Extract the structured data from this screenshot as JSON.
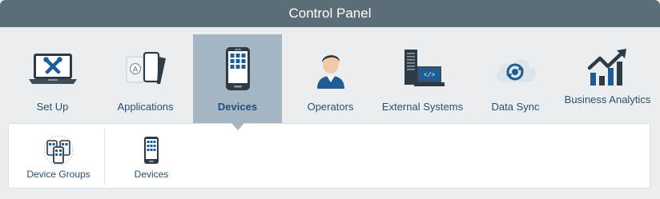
{
  "window": {
    "title": "Control Panel"
  },
  "colors": {
    "titlebar": "#5d6d78",
    "active_tab": "#a5b6c2",
    "label_text": "#2c4e6e",
    "panel_background": "#ebeef0"
  },
  "menu": {
    "items": [
      {
        "label": "Set Up",
        "icon": "laptop-tools-icon",
        "active": false
      },
      {
        "label": "Applications",
        "icon": "applications-icon",
        "active": false
      },
      {
        "label": "Devices",
        "icon": "mobile-device-icon",
        "active": true
      },
      {
        "label": "Operators",
        "icon": "operator-person-icon",
        "active": false
      },
      {
        "label": "External Systems",
        "icon": "server-monitor-icon",
        "active": false
      },
      {
        "label": "Data Sync",
        "icon": "cloud-sync-icon",
        "active": false
      },
      {
        "label": "Business Analytics",
        "icon": "analytics-chart-icon",
        "active": false
      }
    ]
  },
  "submenu": {
    "items": [
      {
        "label": "Device Groups",
        "icon": "device-groups-icon"
      },
      {
        "label": "Devices",
        "icon": "device-icon"
      }
    ]
  }
}
